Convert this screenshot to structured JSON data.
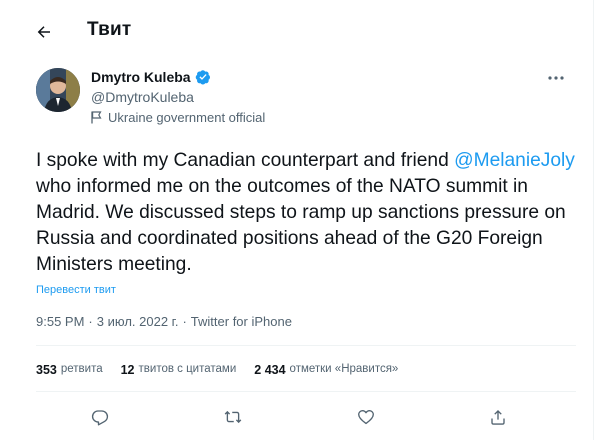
{
  "header": {
    "title": "Твит",
    "back_icon": "arrow-left-icon"
  },
  "author": {
    "name": "Dmytro Kuleba",
    "handle": "@DmytroKuleba",
    "label": "Ukraine government official",
    "verified_icon": "verified-badge-icon",
    "flag_icon": "flag-icon"
  },
  "tweet": {
    "text_before": "I spoke with my Canadian counterpart and friend ",
    "mention": "@MelanieJoly",
    "text_after": " who informed me on the outcomes of the NATO summit in Madrid. We discussed steps to ramp up sanctions pressure on Russia and coordinated positions ahead of the G20 Foreign Ministers meeting.",
    "translate": "Перевести твит"
  },
  "meta": {
    "time": "9:55 PM",
    "sep1": "·",
    "date": "3 июл. 2022 г.",
    "sep2": "·",
    "source": "Twitter for iPhone"
  },
  "stats": {
    "retweets_count": "353",
    "retweets_label": "ретвита",
    "quotes_count": "12",
    "quotes_label": "твитов с цитатами",
    "likes_count": "2 434",
    "likes_label": "отметки «Нравится»"
  },
  "actions": [
    {
      "icon": "reply-icon"
    },
    {
      "icon": "retweet-icon"
    },
    {
      "icon": "like-icon"
    },
    {
      "icon": "share-icon"
    }
  ],
  "colors": {
    "accent": "#1d9bf0",
    "text": "#0f1419",
    "secondary": "#536471",
    "divider": "#eff3f4"
  }
}
